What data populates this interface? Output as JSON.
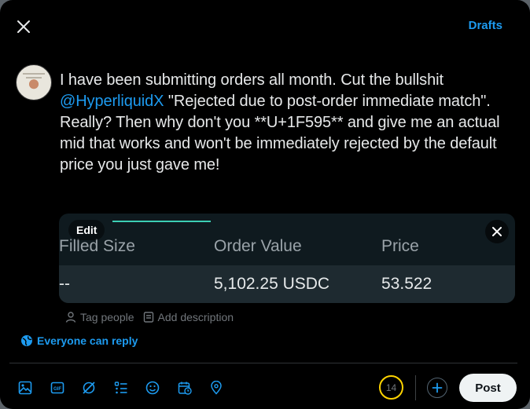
{
  "header": {
    "drafts_label": "Drafts"
  },
  "tweet": {
    "text_before": "I have been submitting orders all month. Cut the bullshit ",
    "mention": "@HyperliquidX",
    "text_after": " \"Rejected due to post-order immediate match\". Really? Then why don't you **U+1F595** and give me an actual mid that works and won't be immediately rejected by the default price you just gave me!"
  },
  "media": {
    "edit_label": "Edit",
    "columns": [
      "Filled Size",
      "Order Value",
      "Price"
    ],
    "row": [
      "--",
      "5,102.25 USDC",
      "53.522"
    ]
  },
  "meta": {
    "tag_people": "Tag people",
    "add_description": "Add description"
  },
  "reply_setting": "Everyone can reply",
  "toolbar": {
    "icons": [
      "image-icon",
      "gif-icon",
      "grok-icon",
      "poll-icon",
      "emoji-icon",
      "schedule-icon",
      "location-icon"
    ]
  },
  "counter": {
    "value": "14"
  },
  "post_label": "Post",
  "colors": {
    "accent": "#1d9bf0",
    "counter_ring": "#ffd400",
    "media_tab": "#3ccfb4"
  }
}
